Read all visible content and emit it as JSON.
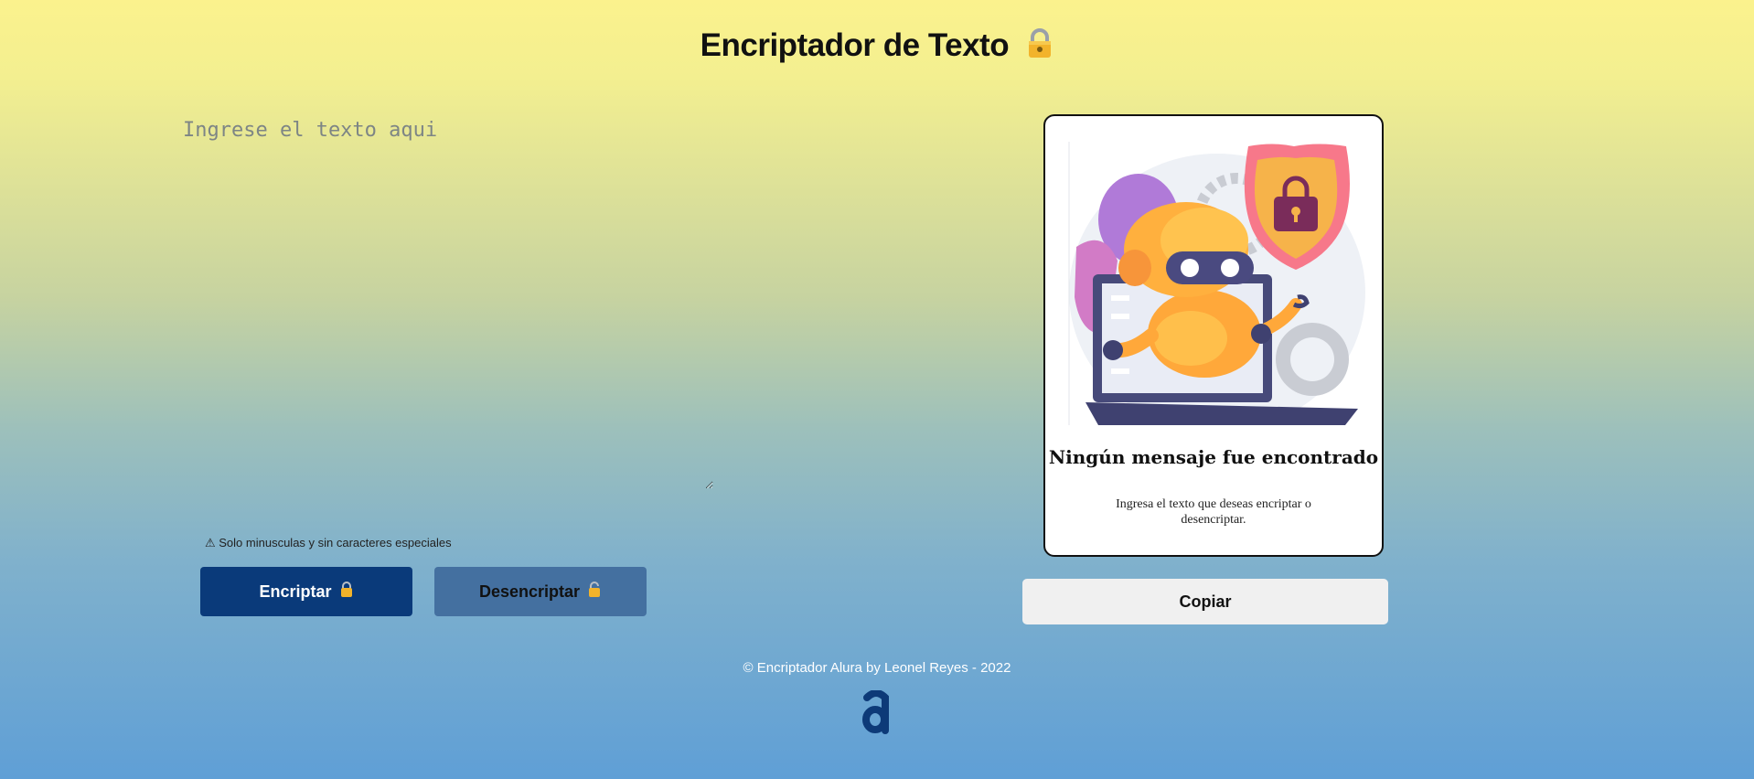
{
  "header": {
    "title": "Encriptador de Texto",
    "title_icon": "lock-icon"
  },
  "input": {
    "placeholder": "Ingrese el texto aqui",
    "value": ""
  },
  "warning": {
    "text": "⚠ Solo minusculas y sin caracteres especiales"
  },
  "buttons": {
    "encrypt_label": "Encriptar",
    "decrypt_label": "Desencriptar",
    "copy_label": "Copiar"
  },
  "output_card": {
    "title": "Ningún mensaje fue encontrado",
    "description": "Ingresa el texto que deseas encriptar o desencriptar.",
    "illustration": "robot-with-lock-illustration"
  },
  "footer": {
    "text": "© Encriptador Alura by Leonel Reyes - 2022",
    "logo": "alura-logo"
  },
  "colors": {
    "encrypt_button": "#0a3a7a",
    "decrypt_button": "#4470a0",
    "copy_button": "#f0f0f0",
    "lock_gold": "#f2b32b"
  }
}
